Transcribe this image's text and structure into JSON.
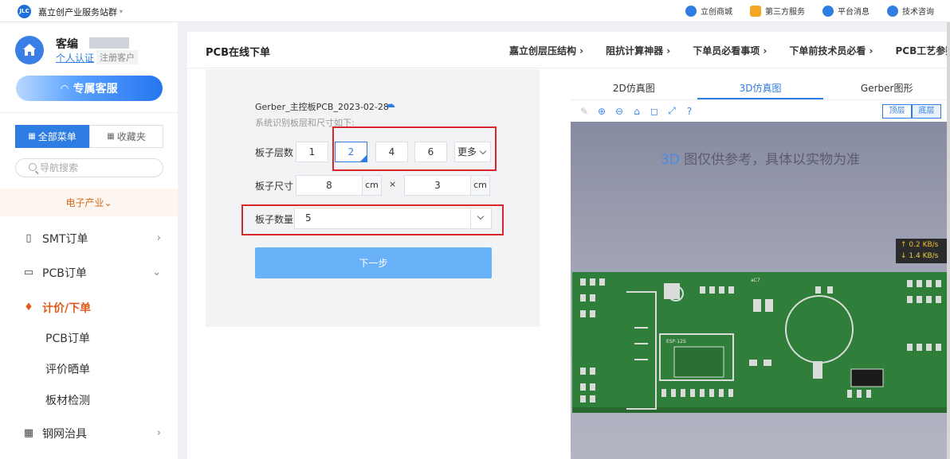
{
  "topbar": {
    "brand": "嘉立创产业服务站群",
    "links": [
      {
        "label": "立创商城",
        "icon": "mall-icon",
        "color": "#2e7de2"
      },
      {
        "label": "第三方服务",
        "icon": "grid-icon",
        "color": "#f5a623"
      },
      {
        "label": "平台消息",
        "icon": "bell-icon",
        "color": "#2e7de2"
      },
      {
        "label": "技术咨询",
        "icon": "chat-icon",
        "color": "#2e7de2"
      }
    ]
  },
  "sidebar": {
    "user": {
      "name": "客编",
      "verify_link": "个人认证",
      "badge": "注册客户"
    },
    "service_button": "专属客服",
    "tabs": [
      {
        "label": "全部菜单",
        "active": true
      },
      {
        "label": "收藏夹",
        "active": false
      }
    ],
    "search_placeholder": "导航搜索",
    "industry": "电子产业",
    "menu": [
      {
        "label": "SMT订单",
        "icon": "book-icon",
        "arrow": "›"
      },
      {
        "label": "PCB订单",
        "icon": "document-icon",
        "arrow": "⌄"
      },
      {
        "label": "计价/下单",
        "icon": "flame-icon",
        "highlighted": true
      },
      {
        "label": "PCB订单",
        "sub": true
      },
      {
        "label": "评价晒单",
        "sub": true
      },
      {
        "label": "板材检测",
        "sub": true
      },
      {
        "label": "钢网治具",
        "icon": "table-icon",
        "arrow": "›"
      }
    ]
  },
  "main": {
    "title": "PCB在线下单",
    "links": [
      "嘉立创层压结构 ›",
      "阻抗计算神器 ›",
      "下单员必看事项 ›",
      "下单前技术员必看 ›",
      "PCB工艺参数"
    ]
  },
  "form": {
    "file_name": "Gerber_主控板PCB_2023-02-28",
    "hint": "系统识别板层和尺寸如下:",
    "layers_label": "板子层数",
    "layers": [
      "1",
      "2",
      "4",
      "6"
    ],
    "selected_layer": "2",
    "more_label": "更多",
    "size_label": "板子尺寸",
    "width": "8",
    "height": "3",
    "unit": "cm",
    "times": "×",
    "qty_label": "板子数量",
    "qty": "5",
    "next_button": "下一步"
  },
  "viewer": {
    "tabs": [
      {
        "label": "2D仿真图",
        "active": false
      },
      {
        "label": "3D仿真图",
        "active": true
      },
      {
        "label": "Gerber图形",
        "active": false
      }
    ],
    "tools": [
      "pencil-icon",
      "zoom-in-icon",
      "zoom-out-icon",
      "home-icon",
      "fit-icon",
      "fullscreen-icon",
      "help-icon"
    ],
    "layer_buttons": [
      "顶层",
      "底层"
    ],
    "note_prefix": "3D",
    "note": "图仅供参考，具体以实物为准",
    "speed_up": "↑ 0.2 KB/s",
    "speed_down": "↓ 1.4 KB/s",
    "board_module_label": "ESP-12S",
    "board_silk": "aC7"
  }
}
